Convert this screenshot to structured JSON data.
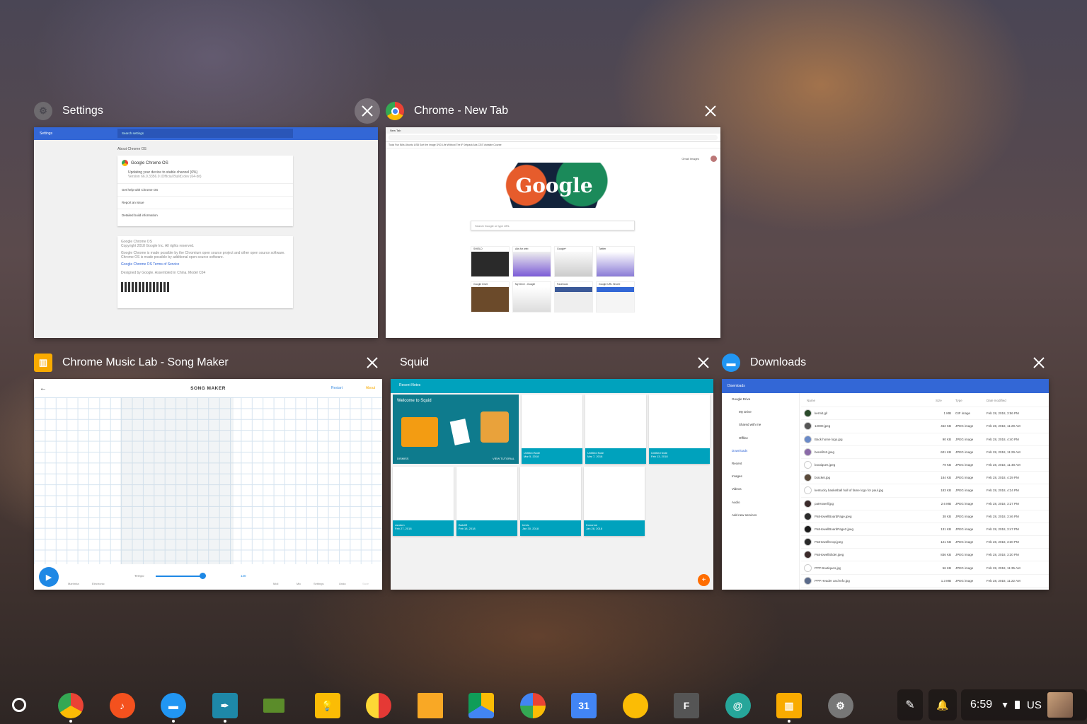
{
  "windows": {
    "settings": {
      "title": "Settings",
      "app_bar_label": "Settings",
      "search_placeholder": "Search settings",
      "section": "About Chrome OS",
      "product": "Google Chrome OS",
      "update_line": "Updating your device to stable channel (6%)",
      "version_line": "Version 66.0.3356.0 (Official Build) dev (64-bit)",
      "rows": [
        "Get help with Chrome OS",
        "Report an issue",
        "Detailed build information"
      ],
      "footer": [
        "Google Chrome OS",
        "Copyright 2018 Google Inc. All rights reserved.",
        "Google Chrome is made possible by the Chromium open source project and other open source software.",
        "Chrome OS is made possible by additional open source software.",
        "Google Chrome OS Terms of Service",
        "Designed by Google. Assembled in China. Model C04"
      ]
    },
    "chrome": {
      "title": "Chrome - New Tab",
      "tab_label": "New Tab",
      "bookmarks": "Tools  Fun  Bills  Ubuntu USB  Sort the image  DVD  Life Without The IP  Jetpack Ads  CSS Variable Course",
      "header_links": "Gmail   Images",
      "logo": "Google",
      "search_placeholder": "Search Google or type URL",
      "tiles": [
        "SHIELD",
        "Ads for web",
        "Google+",
        "Twitter",
        "Google Drive",
        "My Drive - Google",
        "Facebook",
        "Google URL Shorte"
      ]
    },
    "music": {
      "title": "Chrome Music Lab - Song Maker",
      "header": "SONG MAKER",
      "restart": "Restart",
      "about": "About",
      "tempo_label": "Tempo",
      "tempo_value": "120",
      "tools": [
        "Marimba",
        "Electronic",
        "Midi",
        "Mic",
        "Settings",
        "Undo",
        "Save"
      ]
    },
    "squid": {
      "title": "Squid",
      "bar_label": "Recent Notes",
      "welcome": "Welcome to Squid",
      "dismiss": "DISMISS",
      "tutorial": "VIEW TUTORIAL",
      "notes": [
        {
          "title": "Untitled Note",
          "date": "Mar 5, 2018"
        },
        {
          "title": "Untitled Note",
          "date": "Mar 7, 2018"
        },
        {
          "title": "Untitled Note",
          "date": "Feb 13, 2018"
        },
        {
          "title": "random",
          "date": "Feb 27, 2018"
        },
        {
          "title": "Batcliff",
          "date": "Feb 18, 2018"
        },
        {
          "title": "trevis",
          "date": "Jan 30, 2018"
        },
        {
          "title": "Kononne",
          "date": "Jan 28, 2018"
        }
      ]
    },
    "downloads": {
      "title": "Downloads",
      "bar_label": "Downloads",
      "sidebar": [
        "Google Drive",
        "My Drive",
        "Shared with me",
        "Offline",
        "Downloads",
        "Recent",
        "Images",
        "Videos",
        "Audio",
        "Add new services"
      ],
      "columns": [
        "Name",
        "Size",
        "Type",
        "Date modified"
      ],
      "files": [
        [
          "kermit.gif",
          "1 MB",
          "GIF image",
          "Feb 28, 2018, 3:56 PM"
        ],
        [
          "12000.jpeg",
          "462 KB",
          "JPEG image",
          "Feb 28, 2018, 11:29 AM"
        ],
        [
          "Back home logo.jpg",
          "90 KB",
          "JPEG image",
          "Feb 28, 2018, 4:40 PM"
        ],
        [
          "benefits2.jpeg",
          "601 KB",
          "JPEG image",
          "Feb 28, 2018, 11:29 AM"
        ],
        [
          "boutiques.jpeg",
          "79 KB",
          "JPEG image",
          "Feb 28, 2018, 11:48 AM"
        ],
        [
          "bracket.jpg",
          "184 KB",
          "JPEG image",
          "Feb 28, 2018, 4:39 PM"
        ],
        [
          "kentucky basketball hall of fame logo for paul.jpg",
          "183 KB",
          "JPEG image",
          "Feb 28, 2018, 4:24 PM"
        ],
        [
          "patHowell.jpg",
          "2.6 MB",
          "JPEG image",
          "Feb 28, 2018, 3:27 PM"
        ],
        [
          "PatHowellBoardPage.jpeg",
          "38 KB",
          "JPEG image",
          "Feb 28, 2018, 3:46 PM"
        ],
        [
          "PatHowellBoardPage2.jpeg",
          "131 KB",
          "JPEG image",
          "Feb 28, 2018, 3:47 PM"
        ],
        [
          "PatHowellCrop.jpeg",
          "121 KB",
          "JPEG image",
          "Feb 28, 2018, 3:30 PM"
        ],
        [
          "PatHowellSlider.jpeg",
          "836 KB",
          "JPEG image",
          "Feb 28, 2018, 3:30 PM"
        ],
        [
          "PPP Boutiques.jpg",
          "56 KB",
          "JPEG image",
          "Feb 28, 2018, 11:35 AM"
        ],
        [
          "PPP Header and Info.jpg",
          "1.3 MB",
          "JPEG image",
          "Feb 28, 2018, 11:22 AM"
        ]
      ]
    }
  },
  "shelf": {
    "apps": [
      "chrome-icon",
      "music-icon",
      "files-icon",
      "pen-app-icon",
      "shift-icon",
      "keep-icon",
      "ball-icon",
      "analytics-icon",
      "drive-icon",
      "photos-icon",
      "calendar-icon",
      "messages-icon",
      "f-app-icon",
      "at-icon",
      "piano-icon",
      "settings-icon"
    ],
    "calendar_day": "31",
    "f_letter": "F",
    "time": "6:59",
    "locale": "US"
  },
  "colors": {
    "blue": "#3367d6",
    "squid": "#00a2bd",
    "accent": "#ff6d00"
  }
}
